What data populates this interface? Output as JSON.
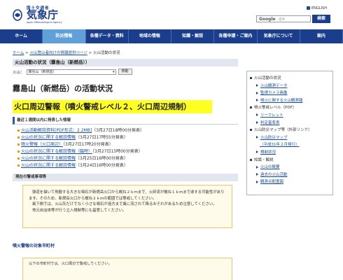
{
  "header": {
    "ministry": "国土交通省",
    "agency": "気象庁",
    "agency_en": "Japan Meteorological Agency",
    "lang_link": "ENGLISH",
    "search_brand": "Google",
    "search_placeholder": "提供",
    "search_button": "検索"
  },
  "nav": {
    "items": [
      {
        "label": "ホーム",
        "active": false
      },
      {
        "label": "防災情報",
        "active": true
      },
      {
        "label": "各種データ・資料",
        "active": false
      },
      {
        "label": "地域の情報",
        "active": false
      },
      {
        "label": "知識・解説",
        "active": false
      },
      {
        "label": "各種申請・ご案内",
        "active": false
      },
      {
        "label": "気象庁について",
        "active": false
      },
      {
        "label": "案内",
        "active": false
      }
    ]
  },
  "breadcrumb": {
    "home": "ホーム",
    "sep": " > ",
    "parent": "火山登山者向けの情報提供ページ",
    "current": "火山活動の状況"
  },
  "main": {
    "section_title": "火山活動の状況（霧島山（新燃岳））",
    "select_label": "火山：",
    "select_value": "霧島山（新燃岳）",
    "move_button": "移動",
    "page_title": "霧島山（新燃岳）の活動状況",
    "alert": "火口周辺警報（噴火警戒レベル２、火口周辺規制）",
    "recent_head": "最近１週間以内に発表した情報",
    "recent_items": [
      {
        "link": "火山活動解説資料[PDF形式：2.2MB]",
        "note": "（3月27日18時00分発表）"
      },
      {
        "link": "火山の状況に関する解説情報",
        "note": "（3月27日17時55分発表）"
      },
      {
        "link": "噴火警報（火口周辺）",
        "note": "（3月27日17時20分発表）"
      },
      {
        "link": "火山の状況に関する解説情報（臨時）",
        "note": "（3月27日15時00分発表）"
      },
      {
        "link": "火山の状況に関する解説情報",
        "note": "（3月25日16時00分発表）"
      },
      {
        "link": "火山の状況に関する解説情報",
        "note": "（3月24日16時00分発表）"
      }
    ],
    "warn_head": "現在の警戒事項等",
    "warn_text": [
      "弾道を描いて飛散する大きな噴石が新燃岳火口から概ね２ｋｍまで、火砕流が概ね１ｋｍまで達する可能性があります。そのため、新燃岳火口から概ね２ｋｍの範囲では警戒してください。",
      "風下側では、火山灰だけでなく小さな噴石が遠方まで風に流されて降るおそれがあるため注意してください。",
      "地元自治体等が行う立入規制等にも留意してください。"
    ],
    "municipalities_head": "噴火警報の対象市町村",
    "municipalities_text": "以下の市町村では、火口周辺で警戒してください。"
  },
  "sidebar": {
    "items": [
      {
        "label": "火山活動の状況",
        "level": 1,
        "kind": "sq",
        "link": false
      },
      {
        "label": "火山観測データ",
        "level": 2,
        "kind": "tri",
        "link": true
      },
      {
        "label": "監視カメラ画像",
        "level": 2,
        "kind": "tri",
        "link": true
      },
      {
        "label": "噴火に関する火山観測報",
        "level": 2,
        "kind": "tri",
        "link": true
      },
      {
        "label": "噴火警戒レベル（PDF）",
        "level": 1,
        "kind": "sq",
        "link": false
      },
      {
        "label": "リーフレット",
        "level": 2,
        "kind": "tri",
        "link": true
      },
      {
        "label": "判定基準表",
        "level": 2,
        "kind": "tri",
        "link": true
      },
      {
        "label": "火山防災マップ等（外部リンク）",
        "level": 1,
        "kind": "sq",
        "link": false
      },
      {
        "label": "火山防災マップ",
        "level": 2,
        "kind": "tri",
        "link": true
      },
      {
        "label": "（平成31年２月発行）",
        "level": 3,
        "kind": "none",
        "link": true
      },
      {
        "label": "規制状況",
        "level": 2,
        "kind": "tri",
        "link": true
      },
      {
        "label": "知識・解説",
        "level": 1,
        "kind": "sq",
        "link": false
      },
      {
        "label": "火山の概要",
        "level": 2,
        "kind": "tri",
        "link": true
      },
      {
        "label": "過去の火山活動",
        "level": 2,
        "kind": "tri",
        "link": true
      },
      {
        "label": "観測点配置図",
        "level": 2,
        "kind": "tri",
        "link": true
      }
    ]
  },
  "colors": {
    "navy": "#1a3d8c",
    "nav_active": "#5fa0d8",
    "alert_yellow": "#ffff22",
    "link": "#1a4e9c"
  }
}
